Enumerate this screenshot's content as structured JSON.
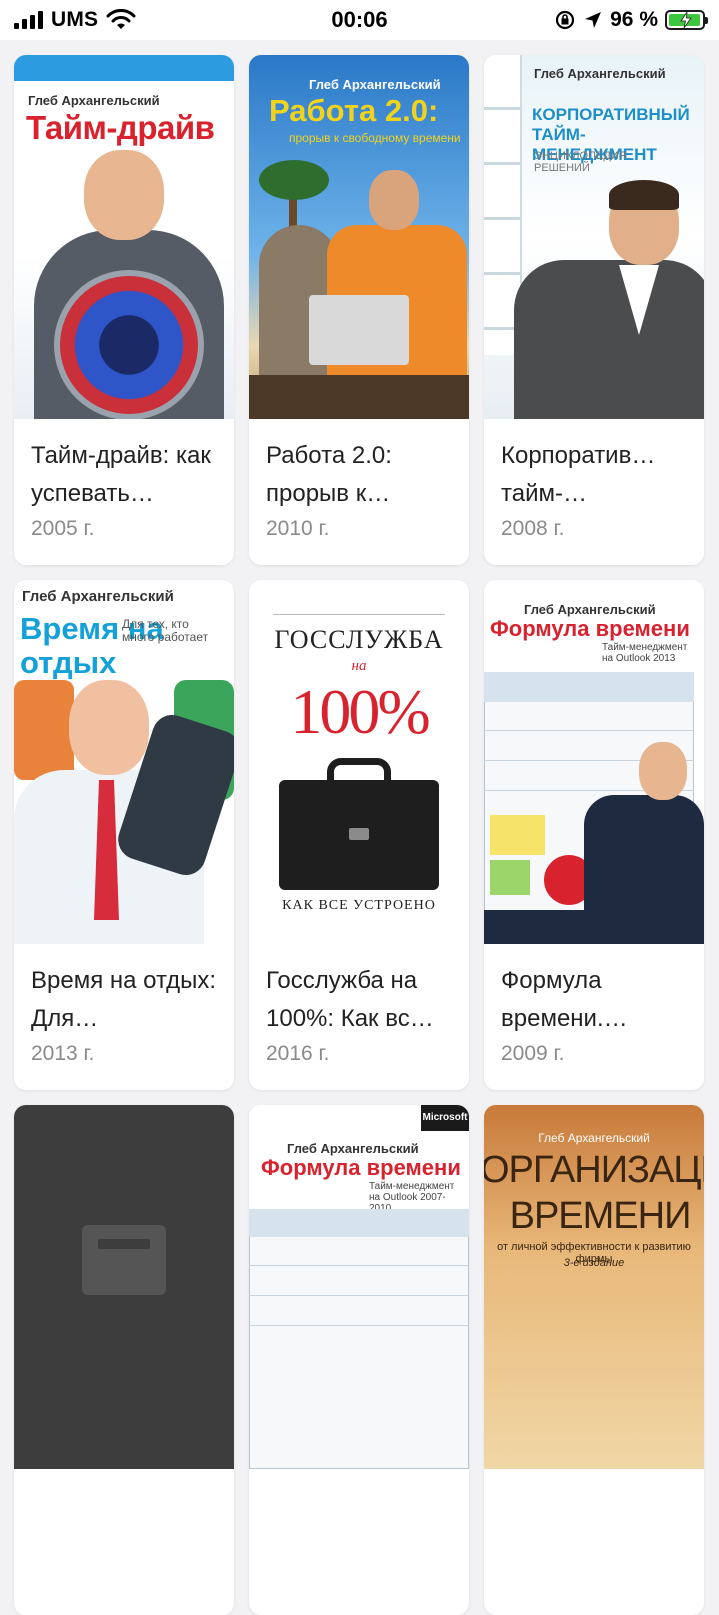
{
  "status_bar": {
    "carrier": "UMS",
    "time": "00:06",
    "battery_percent": "96 %",
    "battery_level": 0.96,
    "icons": [
      "signal-bars-icon",
      "wifi-icon",
      "rotation-lock-icon",
      "location-arrow-icon",
      "battery-charging-icon"
    ]
  },
  "books": [
    {
      "title": "Тайм-драйв: как успевать…",
      "year": "2005 г.",
      "cover": {
        "author": "Глеб Архангельский",
        "title": "Тайм-драйв"
      }
    },
    {
      "title": "Работа 2.0: прорыв к…",
      "year": "2010 г.",
      "cover": {
        "author": "Глеб Архангельский",
        "title": "Работа 2.0:",
        "subtitle": "прорыв к свободному времени"
      }
    },
    {
      "title": "Корпоратив… тайм-…",
      "year": "2008 г.",
      "cover": {
        "author": "Глеб Архангельский",
        "title": "КОРПОРАТИВНЫЙ ТАЙМ-МЕНЕДЖМЕНТ",
        "subtitle": "ЭНЦИКЛОПЕДИЯ РЕШЕНИЙ"
      }
    },
    {
      "title": "Время на отдых: Для…",
      "year": "2013 г.",
      "cover": {
        "author": "Глеб Архангельский",
        "title": "Время на отдых",
        "subtitle": "Для тех, кто много работает"
      }
    },
    {
      "title": "Госслужба на 100%: Как вс…",
      "year": "2016 г.",
      "cover": {
        "title": "ГОССЛУЖБА",
        "na": "на",
        "percent": "100%",
        "footer": "КАК ВСЕ УСТРОЕНО"
      }
    },
    {
      "title": "Формула времени.…",
      "year": "2009 г.",
      "cover": {
        "author": "Глеб Архангельский",
        "title": "Формула времени",
        "subtitle": "Тайм-менеджмент на Outlook 2013"
      }
    },
    {
      "title": "",
      "year": "",
      "cover": {
        "placeholder": true
      }
    },
    {
      "title": "",
      "year": "",
      "cover": {
        "author": "Глеб Архангельский",
        "title": "Формула времени",
        "subtitle": "Тайм-менеджмент на Outlook 2007-2010",
        "badge": "Microsoft"
      }
    },
    {
      "title": "",
      "year": "",
      "cover": {
        "author": "Глеб Архангельский",
        "title": "ОРГАНИЗАЦИЯ ВРЕМЕНИ",
        "subtitle": "от личной эффективности к развитию фирмы",
        "edition": "3-е издание"
      }
    }
  ]
}
